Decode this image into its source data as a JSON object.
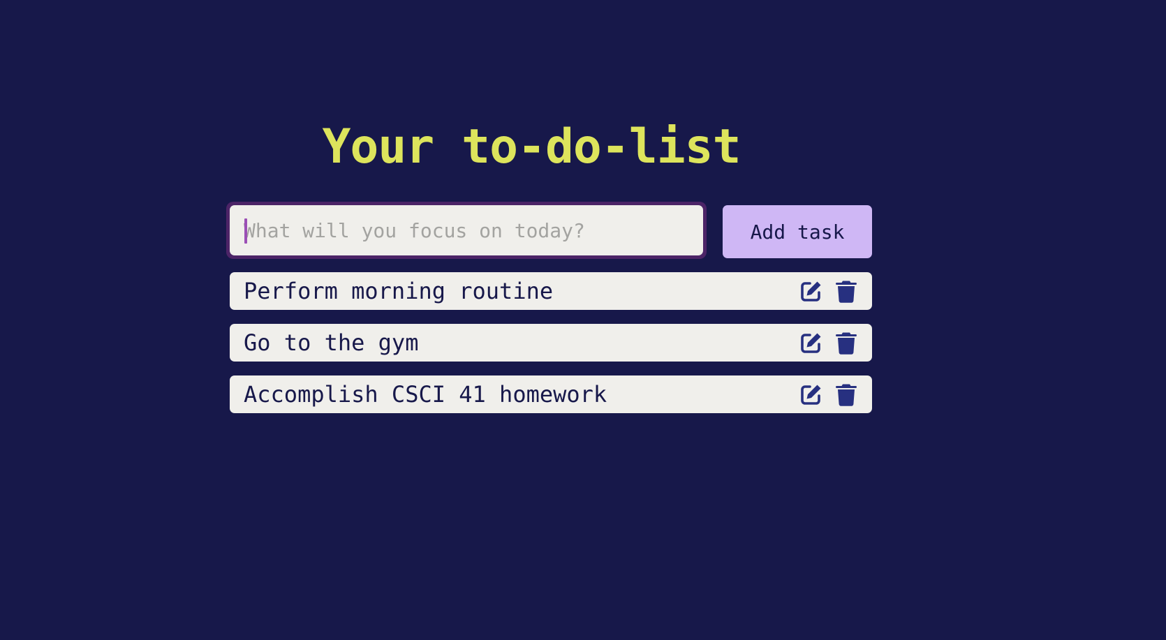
{
  "page": {
    "title": "Your to-do-list"
  },
  "form": {
    "input_placeholder": "What will you focus on today?",
    "input_value": "",
    "add_button_label": "Add task"
  },
  "tasks": [
    {
      "text": "Perform morning routine",
      "edit_icon": "edit-icon",
      "delete_icon": "trash-icon"
    },
    {
      "text": "Go to the gym",
      "edit_icon": "edit-icon",
      "delete_icon": "trash-icon"
    },
    {
      "text": "Accomplish CSCI 41 homework",
      "edit_icon": "edit-icon",
      "delete_icon": "trash-icon"
    }
  ],
  "colors": {
    "background": "#17184a",
    "title": "#dde45c",
    "input_focus_ring": "#4c2467",
    "surface": "#f0efeb",
    "button": "#cfb7f5",
    "icon": "#273080",
    "text": "#17184a"
  }
}
